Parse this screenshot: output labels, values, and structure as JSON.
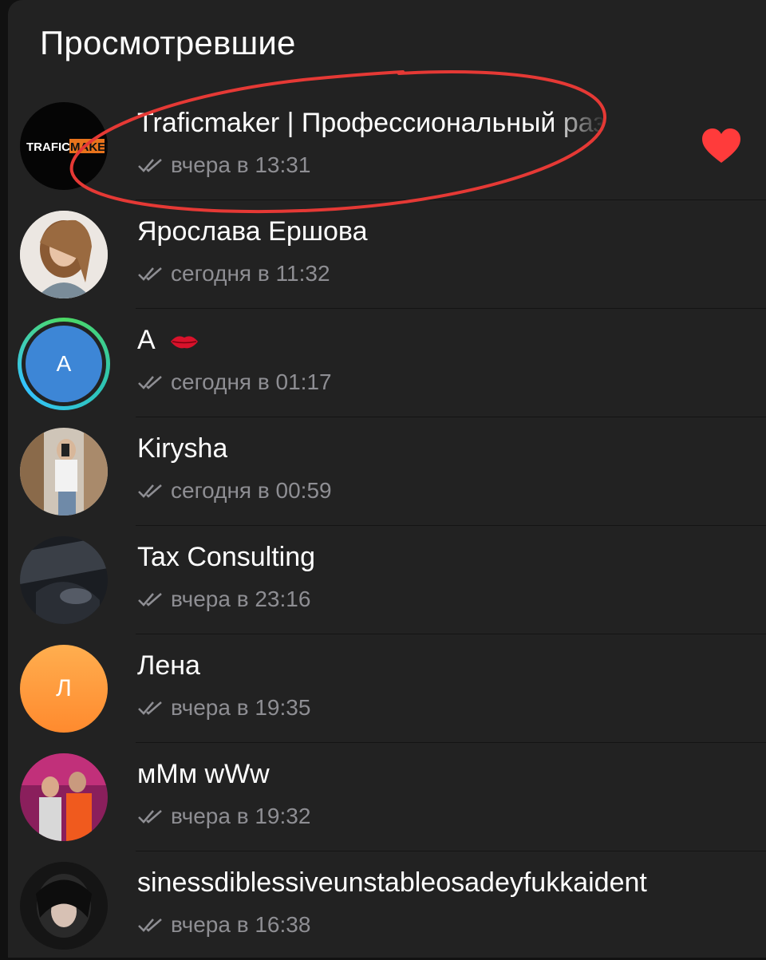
{
  "header": {
    "title": "Просмотревшие"
  },
  "viewers": [
    {
      "name": "Traficmaker | Профессиональный раз",
      "time": "вчера в 13:31",
      "avatar_text": "TRAFICMAKER",
      "avatar_text_a": "TRAFIC",
      "avatar_text_b": "MAKER",
      "reaction": "heart-icon"
    },
    {
      "name": "Ярослава Ершова",
      "time": "сегодня в 11:32"
    },
    {
      "name": "А",
      "time": "сегодня в 01:17",
      "avatar_letter": "А",
      "emoji": "lips-icon"
    },
    {
      "name": "Kirysha",
      "time": "сегодня в 00:59"
    },
    {
      "name": "Tax Consulting",
      "time": "вчера в 23:16"
    },
    {
      "name": "Лена",
      "time": "вчера в 19:35",
      "avatar_letter": "Л"
    },
    {
      "name": "мМм wWw",
      "time": "вчера в 19:32"
    },
    {
      "name": "sinessdiblessiveunstableosadeyfukkaident",
      "time": "вчера в 16:38"
    }
  ],
  "colors": {
    "background": "#222222",
    "accent_heart": "#ff3b3b",
    "annotation": "#e53935",
    "avatar_blue": "#3d86d6",
    "avatar_orange": "#ff9a3c"
  }
}
